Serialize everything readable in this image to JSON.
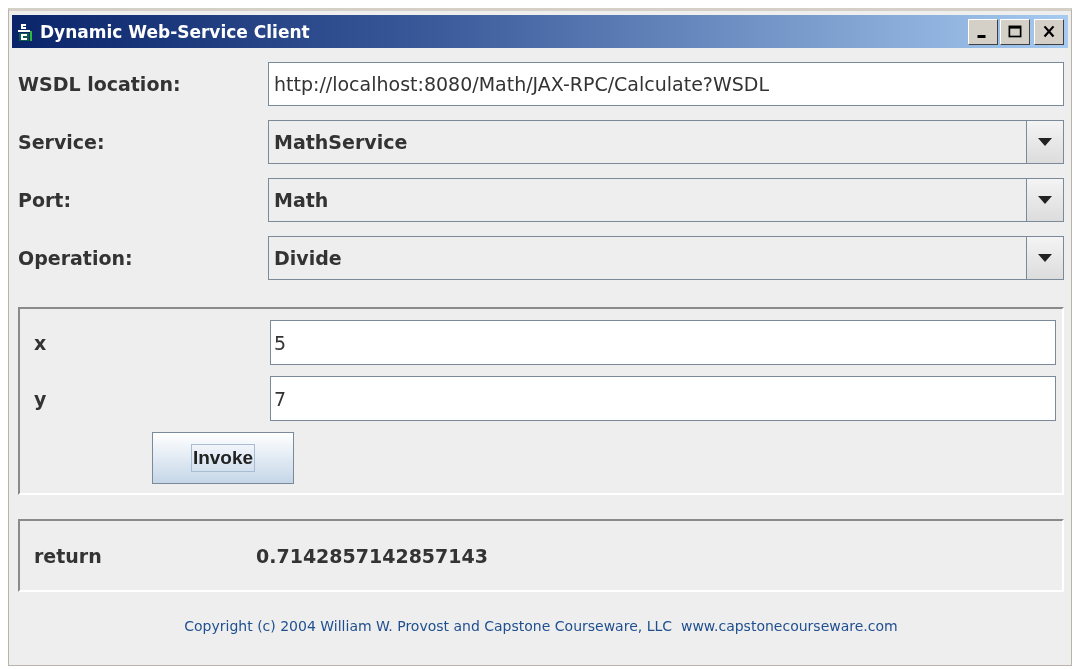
{
  "window": {
    "title": "Dynamic Web-Service Client"
  },
  "form": [
    {
      "kind": "text",
      "label": "WSDL location:",
      "value": "http://localhost:8080/Math/JAX-RPC/Calculate?WSDL"
    },
    {
      "kind": "combo",
      "label": "Service:",
      "value": "MathService"
    },
    {
      "kind": "combo",
      "label": "Port:",
      "value": "Math"
    },
    {
      "kind": "combo",
      "label": "Operation:",
      "value": "Divide"
    }
  ],
  "parameters": [
    {
      "name": "x",
      "value": "5"
    },
    {
      "name": "y",
      "value": "7"
    }
  ],
  "invoke_button": "Invoke",
  "result": {
    "name": "return",
    "value": "0.7142857142857143"
  },
  "footer": "Copyright (c) 2004 William W. Provost and Capstone Courseware, LLC  www.capstonecourseware.com"
}
